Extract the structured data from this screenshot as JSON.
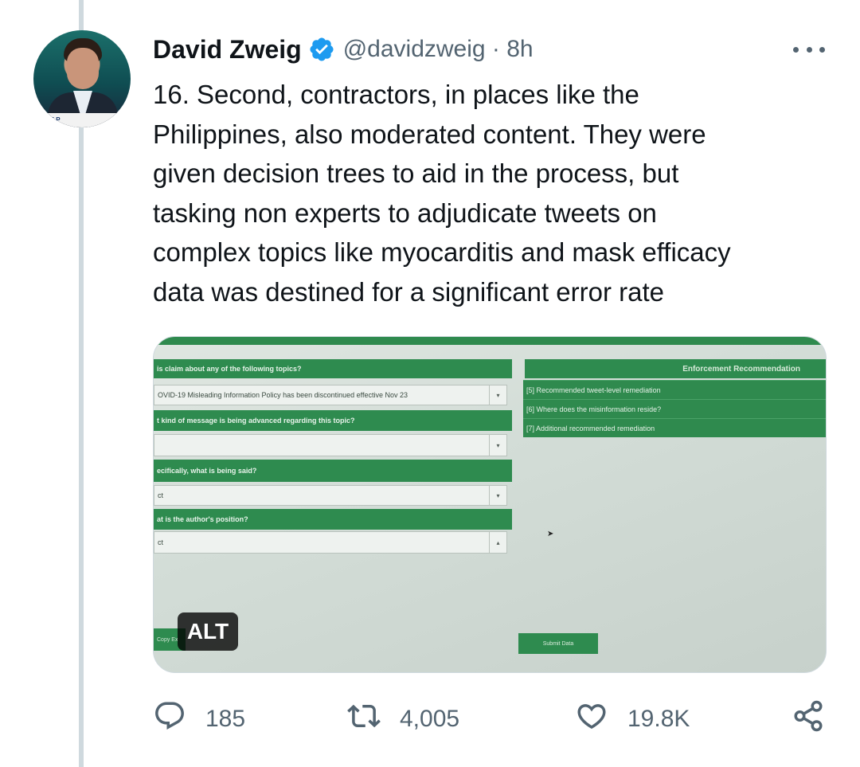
{
  "tweet": {
    "author_name": "David Zweig",
    "verified_icon": "verified-badge-icon",
    "handle_time": "@davidzweig · 8h",
    "text": "16. Second, contractors, in places like the\nPhilippines, also moderated content. They were\ngiven decision trees to aid in the process, but\ntasking non experts to adjudicate tweets on\ncomplex topics like myocarditis and mask efficacy\ndata was destined for a significant error rate",
    "avatar_banner": "THE P"
  },
  "media": {
    "alt_label": "ALT",
    "questions": [
      {
        "label": "is claim about any of the following topics?",
        "value": "OVID-19 Misleading Information Policy has been discontinued effective Nov 23"
      },
      {
        "label": "t kind of message is being advanced regarding this topic?",
        "value": ""
      },
      {
        "label": "ecifically, what is being said?",
        "value": "ct"
      },
      {
        "label": "at is the author's position?",
        "value": "ct"
      }
    ],
    "rec_title": "Enforcement Recommendation",
    "rec_items": [
      "[5] Recommended tweet-level remediation",
      "[6] Where does the misinformation reside?",
      "[7] Additional recommended remediation"
    ],
    "submit_label": "Submit Data",
    "copy_label": "Copy Ex"
  },
  "actions": {
    "reply": {
      "icon": "reply-icon",
      "count": "185"
    },
    "retweet": {
      "icon": "retweet-icon",
      "count": "4,005"
    },
    "like": {
      "icon": "heart-icon",
      "count": "19.8K"
    },
    "share": {
      "icon": "share-icon"
    }
  },
  "colors": {
    "text": "#0f1419",
    "secondary": "#536471",
    "verified": "#1d9bf0",
    "form_green": "#2e8b4f"
  }
}
